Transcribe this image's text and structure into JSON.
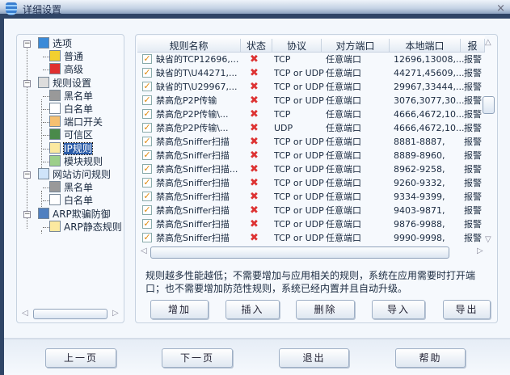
{
  "window": {
    "title": "详细设置",
    "close": "×"
  },
  "tree": {
    "items": [
      {
        "label": "选项",
        "icon": "gear-icon"
      },
      {
        "label": "普通",
        "icon": "gear-star-icon"
      },
      {
        "label": "高级",
        "icon": "gear-red-star-icon"
      },
      {
        "label": "规则设置",
        "icon": "rules-icon"
      },
      {
        "label": "黑名单",
        "icon": "document-gray-icon"
      },
      {
        "label": "白名单",
        "icon": "document-icon"
      },
      {
        "label": "端口开关",
        "icon": "port-switch-icon"
      },
      {
        "label": "可信区",
        "icon": "computer-network-icon"
      },
      {
        "label": "IP规则",
        "icon": "ip-icon"
      },
      {
        "label": "模块规则",
        "icon": "list-icon"
      },
      {
        "label": "网站访问规则",
        "icon": "ie-icon"
      },
      {
        "label": "黑名单",
        "icon": "document-gray-icon"
      },
      {
        "label": "白名单",
        "icon": "document-icon"
      },
      {
        "label": "ARP欺骗防御",
        "icon": "arp-icon"
      },
      {
        "label": "ARP静态规则",
        "icon": "tool-icon"
      }
    ],
    "selected": "IP规则"
  },
  "table": {
    "columns": [
      "规则名称",
      "状态",
      "协议",
      "对方端口",
      "本地端口",
      "报"
    ],
    "rows": [
      [
        "缺省的TCP12696,...",
        "TCP",
        "任意端口",
        "12696,13008,...",
        "报警"
      ],
      [
        "缺省的T\\U44271,...",
        "TCP or UDP",
        "任意端口",
        "44271,45609,...",
        "报警"
      ],
      [
        "缺省的T\\U29967,...",
        "TCP or UDP",
        "任意端口",
        "29967,33444,...",
        "报警"
      ],
      [
        "禁高危P2P传输",
        "TCP or UDP",
        "任意端口",
        "3076,3077,30...",
        "报警"
      ],
      [
        "禁高危P2P传输\\...",
        "TCP",
        "任意端口",
        "4666,4672,10...",
        "报警"
      ],
      [
        "禁高危P2P传输\\...",
        "UDP",
        "任意端口",
        "4666,4672,10...",
        "报警"
      ],
      [
        "禁高危Sniffer扫描",
        "TCP or UDP",
        "任意端口",
        "8881-8887,",
        "报警"
      ],
      [
        "禁高危Sniffer扫描",
        "TCP or UDP",
        "任意端口",
        "8889-8960,",
        "报警"
      ],
      [
        "禁高危Sniffer扫描...",
        "TCP or UDP",
        "任意端口",
        "8962-9258,",
        "报警"
      ],
      [
        "禁高危Sniffer扫描",
        "TCP or UDP",
        "任意端口",
        "9260-9332,",
        "报警"
      ],
      [
        "禁高危Sniffer扫描",
        "TCP or UDP",
        "任意端口",
        "9334-9399,",
        "报警"
      ],
      [
        "禁高危Sniffer扫描",
        "TCP or UDP",
        "任意端口",
        "9403-9871,",
        "报警"
      ],
      [
        "禁高危Sniffer扫描",
        "TCP or UDP",
        "任意端口",
        "9876-9988,",
        "报警"
      ],
      [
        "禁高危Sniffer扫描",
        "TCP or UDP",
        "任意端口",
        "9990-9998,",
        "报警"
      ]
    ]
  },
  "note": "规则越多性能越低；不需要增加与应用相关的规则，系统在应用需要时打开端口；也不需要增加防范性规则，系统已经内置并且自动升级。",
  "actions": [
    "增加",
    "插入",
    "删除",
    "导入",
    "导出"
  ],
  "footer": [
    "上一页",
    "下一页",
    "退出",
    "帮助"
  ]
}
